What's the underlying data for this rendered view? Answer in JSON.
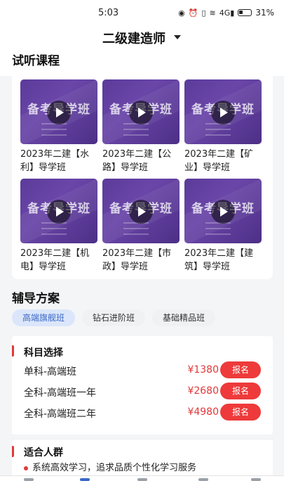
{
  "status": {
    "time": "5:03",
    "signal_text": "4G",
    "battery": "31%"
  },
  "header": {
    "title": "二级建造师"
  },
  "trial_section": {
    "title": "试听课程"
  },
  "courses": [
    {
      "thumb_title": "备考导学班",
      "name": "2023年二建【水利】导学班"
    },
    {
      "thumb_title": "备考导学班",
      "name": "2023年二建【公路】导学班"
    },
    {
      "thumb_title": "备考导学班",
      "name": "2023年二建【矿业】导学班"
    },
    {
      "thumb_title": "备考导学班",
      "name": "2023年二建【机电】导学班"
    },
    {
      "thumb_title": "备考导学班",
      "name": "2023年二建【市政】导学班"
    },
    {
      "thumb_title": "备考导学班",
      "name": "2023年二建【建筑】导学班"
    }
  ],
  "plan_section": {
    "title": "辅导方案"
  },
  "tabs": [
    "高端旗舰班",
    "钻石进阶班",
    "基础精品班"
  ],
  "subjects": {
    "title": "科目选择",
    "rows": [
      {
        "name": "单科-高端班",
        "price": "¥1380",
        "button": "报名"
      },
      {
        "name": "全科-高端班一年",
        "price": "¥2680",
        "button": "报名"
      },
      {
        "name": "全科-高端班二年",
        "price": "¥4980",
        "button": "报名"
      }
    ]
  },
  "audience": {
    "title": "适合人群",
    "bullet": "系统高效学习，追求品质个性化学习服务"
  },
  "colors": {
    "accent_red": "#ee3a3a",
    "accent_blue": "#3a68c8",
    "thumb_purple": "#5b3b9a"
  }
}
